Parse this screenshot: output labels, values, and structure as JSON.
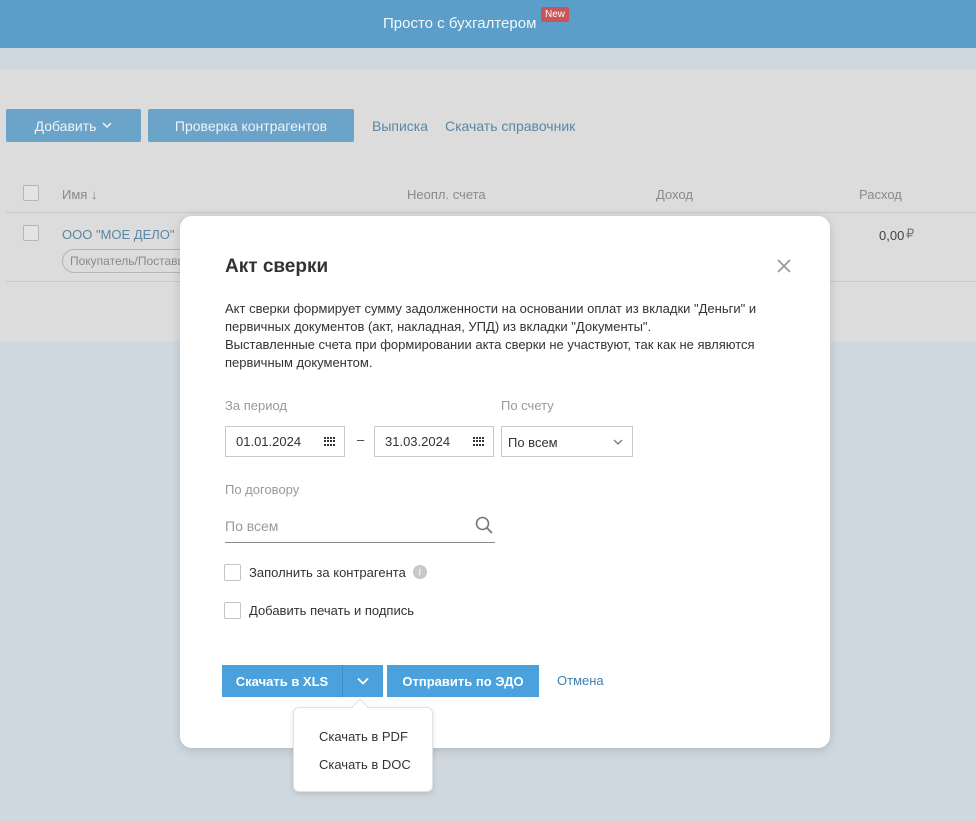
{
  "topbar": {
    "title": "Просто с бухгалтером",
    "badge": "New"
  },
  "toolbar": {
    "add_label": "Добавить",
    "check_label": "Проверка контрагентов",
    "statement_link": "Выписка",
    "download_ref_link": "Скачать справочник"
  },
  "table": {
    "headers": {
      "name": "Имя ↓",
      "unpaid": "Неопл. счета",
      "income": "Доход",
      "expense": "Расход"
    },
    "rows": [
      {
        "name": "ООО \"МОЕ ДЕЛО\"",
        "tag": "Покупатель/Поставщик",
        "expense": "0,00",
        "currency": "₽"
      }
    ]
  },
  "modal": {
    "title": "Акт сверки",
    "description": [
      "Акт сверки формирует сумму задолженности на основании оплат из вкладки \"Деньги\" и",
      "первичных документов (акт, накладная, УПД) из вкладки \"Документы\".",
      "Выставленные счета при формировании акта сверки не участвуют, так как не являются",
      "первичным документом."
    ],
    "period_label": "За период",
    "date_from": "01.01.2024",
    "date_separator": "–",
    "date_to": "31.03.2024",
    "account_label": "По счету",
    "account_value": "По всем",
    "contract_label": "По договору",
    "contract_placeholder": "По всем",
    "fill_for_counterparty": "Заполнить за контрагента",
    "add_stamp": "Добавить печать и подпись",
    "download_xls": "Скачать в XLS",
    "send_edo": "Отправить по ЭДО",
    "cancel": "Отмена"
  },
  "dropdown": {
    "items": [
      "Скачать в PDF",
      "Скачать в DOC"
    ]
  },
  "colors": {
    "accent": "#4aa1db",
    "topbar": "#5b9ec9",
    "badge": "#c9545a"
  },
  "icons": [
    "close-icon",
    "calendar-icon",
    "chevron-down-icon",
    "search-icon",
    "info-icon"
  ]
}
